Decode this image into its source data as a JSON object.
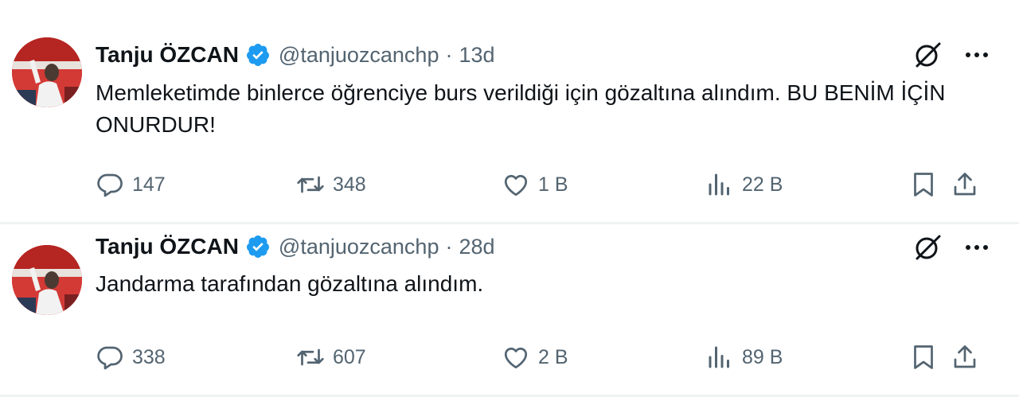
{
  "tweets": [
    {
      "name": "Tanju ÖZCAN",
      "handle": "@tanjuozcanchp",
      "separator": "·",
      "time": "13d",
      "text": "Memleketimde binlerce öğrenciye burs verildiği için gözaltına alındım. BU BENİM İÇİN ONURDUR!",
      "replies": "147",
      "retweets": "348",
      "likes": "1 B",
      "views": "22 B"
    },
    {
      "name": "Tanju ÖZCAN",
      "handle": "@tanjuozcanchp",
      "separator": "·",
      "time": "28d",
      "text": "Jandarma tarafından gözaltına alındım.",
      "replies": "338",
      "retweets": "607",
      "likes": "2 B",
      "views": "89 B"
    }
  ],
  "colors": {
    "text": "#0f1419",
    "secondary": "#536471",
    "verified": "#1d9bf0",
    "divider": "#eff3f4"
  },
  "icons": [
    "verified-badge-icon",
    "grok-icon",
    "more-icon",
    "reply-icon",
    "retweet-icon",
    "like-icon",
    "views-icon",
    "bookmark-icon",
    "share-icon"
  ]
}
